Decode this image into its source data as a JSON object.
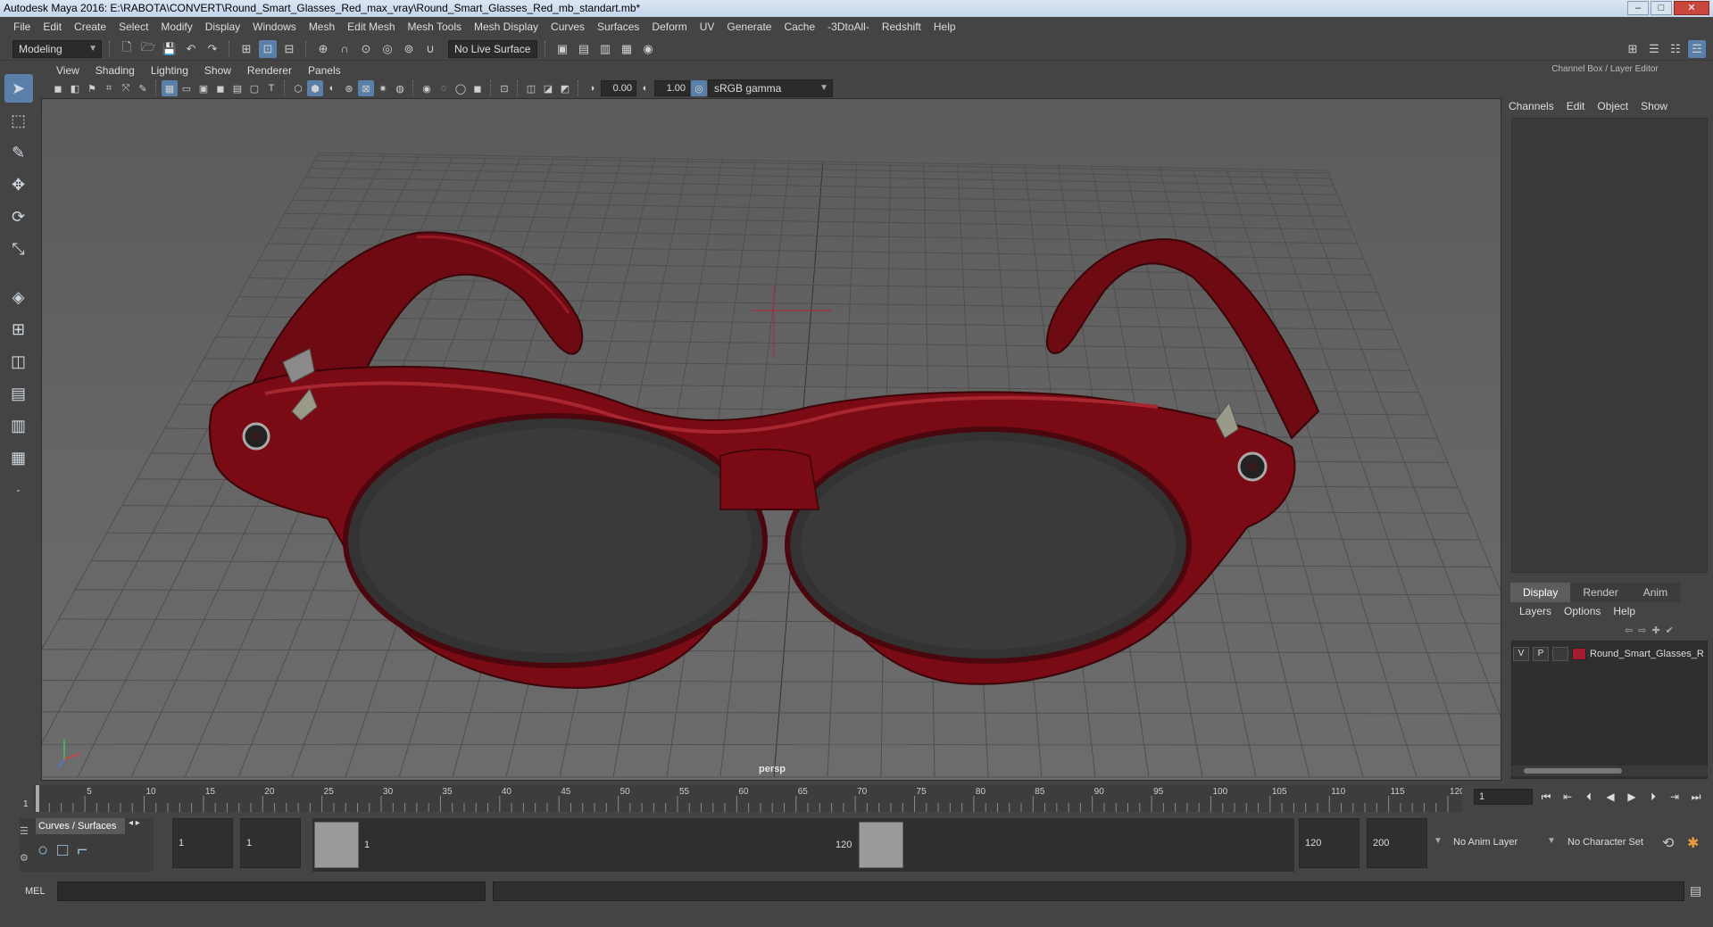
{
  "window": {
    "title": "Autodesk Maya 2016: E:\\RABOTA\\CONVERT\\Round_Smart_Glasses_Red_max_vray\\Round_Smart_Glasses_Red_mb_standart.mb*",
    "minimize": "–",
    "maximize": "□",
    "close": "✕"
  },
  "menubar": [
    "File",
    "Edit",
    "Create",
    "Select",
    "Modify",
    "Display",
    "Windows",
    "Mesh",
    "Edit Mesh",
    "Mesh Tools",
    "Mesh Display",
    "Curves",
    "Surfaces",
    "Deform",
    "UV",
    "Generate",
    "Cache",
    "-3DtoAll-",
    "Redshift",
    "Help"
  ],
  "statusline": {
    "mode": "Modeling",
    "live_surface": "No Live Surface"
  },
  "panel": {
    "menus": [
      "View",
      "Shading",
      "Lighting",
      "Show",
      "Renderer",
      "Panels"
    ],
    "exposure": "0.00",
    "gamma": "1.00",
    "color_space": "sRGB gamma",
    "camera_label": "persp"
  },
  "channel_box": {
    "title": "Channel Box / Layer Editor",
    "menus": [
      "Channels",
      "Edit",
      "Object",
      "Show"
    ]
  },
  "layer_editor": {
    "tabs": [
      "Display",
      "Render",
      "Anim"
    ],
    "active_tab": "Display",
    "menus": [
      "Layers",
      "Options",
      "Help"
    ],
    "layers": [
      {
        "v": "V",
        "p": "P",
        "name": "Round_Smart_Glasses_R",
        "color": "#a31c31"
      }
    ]
  },
  "timeline": {
    "ticks": [
      "5",
      "10",
      "15",
      "20",
      "25",
      "30",
      "35",
      "40",
      "45",
      "50",
      "55",
      "60",
      "65",
      "70",
      "75",
      "80",
      "85",
      "90",
      "95",
      "100",
      "105",
      "110",
      "115",
      "120"
    ],
    "start_marker": "1",
    "current_frame": "1"
  },
  "range": {
    "shelf_tab": "Curves / Surfaces",
    "start_frame": "1",
    "anim_start": "1",
    "range_start": "1",
    "range_end": "120",
    "anim_end": "120",
    "end_frame": "200",
    "anim_layer": "No Anim Layer",
    "character_set": "No Character Set"
  },
  "command_line": {
    "label": "MEL"
  },
  "colors": {
    "frame_red": "#7a0a14",
    "accent": "#5a7fa8"
  }
}
